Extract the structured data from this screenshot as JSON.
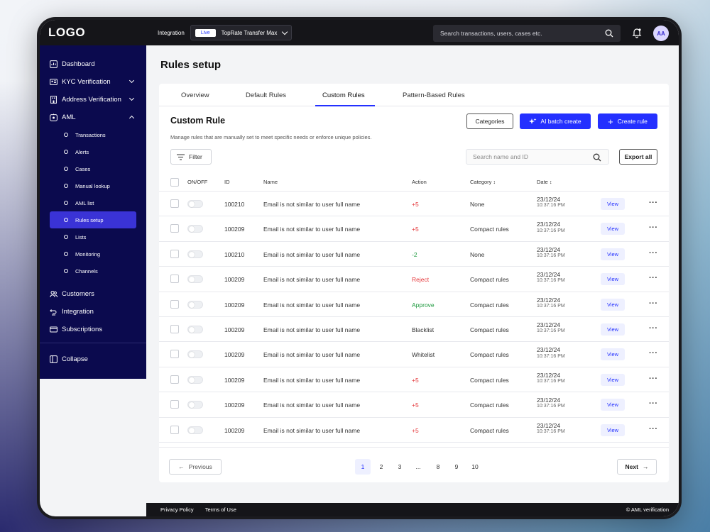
{
  "header": {
    "logo": "LOGO",
    "integration_label": "Integration",
    "env_badge": "Live",
    "env_name": "TopRate Transfer Max",
    "search_placeholder": "Search transactions, users, cases etc.",
    "avatar_initials": "AA"
  },
  "sidebar": {
    "items": [
      {
        "label": "Dashboard",
        "icon": "dashboard-icon"
      },
      {
        "label": "KYC Verification",
        "icon": "id-card-icon"
      },
      {
        "label": "Address Verification",
        "icon": "building-icon"
      },
      {
        "label": "AML",
        "icon": "shield-icon"
      }
    ],
    "aml_sub": [
      {
        "label": "Transactions"
      },
      {
        "label": "Alerts"
      },
      {
        "label": "Cases"
      },
      {
        "label": "Manual lookup"
      },
      {
        "label": "AML list"
      },
      {
        "label": "Rules setup"
      },
      {
        "label": "Lists"
      },
      {
        "label": "Monitoring"
      },
      {
        "label": "Channels"
      }
    ],
    "bottom_items": [
      {
        "label": "Customers"
      },
      {
        "label": "Integration"
      },
      {
        "label": "Subscriptions"
      }
    ],
    "collapse_label": "Collapse"
  },
  "page": {
    "title": "Rules setup",
    "tabs": [
      "Overview",
      "Default Rules",
      "Custom Rules",
      "Pattern-Based Rules"
    ],
    "section_title": "Custom Rule",
    "section_desc": "Manage rules that are manually set to meet specific needs or enforce unique policies.",
    "categories_btn": "Categories",
    "ai_batch_btn": "AI batch create",
    "create_rule_btn": "Create rule",
    "filter_btn": "Filter",
    "search_placeholder": "Search name and ID",
    "export_btn": "Export all"
  },
  "table": {
    "headers": {
      "onoff": "ON/OFF",
      "id": "ID",
      "name": "Name",
      "action": "Action",
      "category": "Category",
      "date": "Date"
    },
    "rows": [
      {
        "id": "100210",
        "name": "Email is not similar to user full name",
        "action": "+5",
        "category": "None",
        "date": "23/12/24",
        "time": "10:37:16 PM",
        "view": "View"
      },
      {
        "id": "100209",
        "name": "Email is not similar to user full name",
        "action": "+5",
        "category": "Compact rules",
        "date": "23/12/24",
        "time": "10:37:16 PM",
        "view": "View"
      },
      {
        "id": "100210",
        "name": "Email is not similar to user full name",
        "action": "-2",
        "category": "None",
        "date": "23/12/24",
        "time": "10:37:16 PM",
        "view": "View"
      },
      {
        "id": "100209",
        "name": "Email is not similar to user full name",
        "action": "Reject",
        "category": "Compact rules",
        "date": "23/12/24",
        "time": "10:37:16 PM",
        "view": "View"
      },
      {
        "id": "100209",
        "name": "Email is not similar to user full name",
        "action": "Approve",
        "category": "Compact rules",
        "date": "23/12/24",
        "time": "10:37:16 PM",
        "view": "View"
      },
      {
        "id": "100209",
        "name": "Email is not similar to user full name",
        "action": "Blacklist",
        "category": "Compact rules",
        "date": "23/12/24",
        "time": "10:37:16 PM",
        "view": "View"
      },
      {
        "id": "100209",
        "name": "Email is not similar to user full name",
        "action": "Whitelist",
        "category": "Compact rules",
        "date": "23/12/24",
        "time": "10:37:16 PM",
        "view": "View"
      },
      {
        "id": "100209",
        "name": "Email is not similar to user full name",
        "action": "+5",
        "category": "Compact rules",
        "date": "23/12/24",
        "time": "10:37:16 PM",
        "view": "View"
      },
      {
        "id": "100209",
        "name": "Email is not similar to user full name",
        "action": "+5",
        "category": "Compact rules",
        "date": "23/12/24",
        "time": "10:37:16 PM",
        "view": "View"
      },
      {
        "id": "100209",
        "name": "Email is not similar to user full name",
        "action": "+5",
        "category": "Compact rules",
        "date": "23/12/24",
        "time": "10:37:16 PM",
        "view": "View"
      }
    ]
  },
  "pagination": {
    "prev": "Previous",
    "next": "Next",
    "pages": [
      "1",
      "2",
      "3",
      "...",
      "8",
      "9",
      "10"
    ],
    "current": "1"
  },
  "footer": {
    "privacy": "Privacy Policy",
    "terms": "Terms of Use",
    "copyright": "© AML verification"
  },
  "colors": {
    "brand": "#2430ff",
    "sidebar_bg": "#0b0a4e",
    "positive": "#e5383b",
    "negative": "#1e9a3f"
  }
}
